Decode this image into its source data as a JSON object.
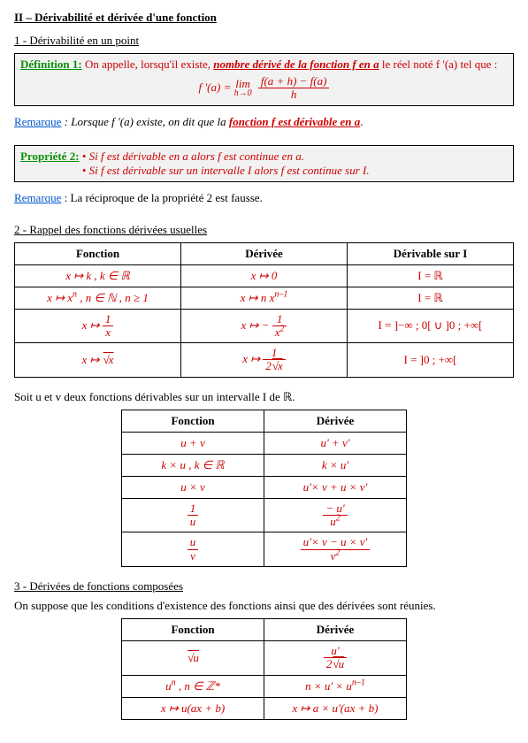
{
  "title": "II – Dérivabilité et dérivée d'une fonction",
  "sec1": "1 - Dérivabilité en un point",
  "def1": {
    "label": "Définition 1:",
    "text_before": " On appelle, lorsqu'il existe, ",
    "term": "nombre dérivé de la fonction  f  en  a",
    "text_after": "  le réel noté  f '(a)  tel que :",
    "formula_left": "f '(a) = ",
    "lim_top": "lim",
    "lim_bot": "h→0",
    "num": "f(a + h) − f(a)",
    "den": "h"
  },
  "rem1": {
    "label": "Remarque",
    "before": " : Lorsque  f '(a)  existe, on dit que la ",
    "bold": "fonction  f  est dérivable en  a",
    "after": "."
  },
  "prop2": {
    "label": "Propriété 2:",
    "line1": " •  Si  f  est dérivable en  a  alors  f  est continue en  a.",
    "line2": " •  Si  f  est dérivable sur un intervalle  I  alors  f  est continue sur I."
  },
  "rem2": {
    "label": "Remarque",
    "text": " : La réciproque de la propriété 2 est fausse."
  },
  "sec2": "2 - Rappel des fonctions dérivées usuelles",
  "t1": {
    "h1": "Fonction",
    "h2": "Dérivée",
    "h3": "Dérivable sur  I",
    "r1c1": "x ↦ k ,  k ∈ ℝ",
    "r1c2": "x ↦ 0",
    "r1c3": "I = ℝ",
    "r2c1_a": "x ↦ x",
    "r2c1_exp": "n",
    "r2c1_b": " ,  n ∈ ℕ ,  n ≥ 1",
    "r2c2_a": "x ↦ n x",
    "r2c2_exp": "n–1",
    "r2c3": "I = ℝ",
    "r3c1_pre": "x ↦ ",
    "r3c1_num": "1",
    "r3c1_den": "x",
    "r3c2_pre": "x ↦ − ",
    "r3c2_num": "1",
    "r3c2_den": "x",
    "r3c2_exp": "2",
    "r3c3": "I = ]−∞ ; 0[ ∪ ]0 ; +∞[",
    "r4c1_pre": "x ↦ ",
    "r4c1_sq": "x",
    "r4c2_pre": "x ↦ ",
    "r4c2_num": "1",
    "r4c2_den_a": "2",
    "r4c2_den_sq": "x",
    "r4c3": "I = ]0 ; +∞["
  },
  "t2intro": "Soit  u  et  v  deux fonctions dérivables sur un intervalle  I  de  ℝ.",
  "t2": {
    "h1": "Fonction",
    "h2": "Dérivée",
    "r1c1": "u + v",
    "r1c2": "u' + v'",
    "r2c1": "k × u ,  k ∈ ℝ",
    "r2c2": "k × u'",
    "r3c1": "u × v",
    "r3c2": "u'× v + u × v'",
    "r4c1_num": "1",
    "r4c1_den": "u",
    "r4c2_num": "− u'",
    "r4c2_den": "u",
    "r4c2_exp": "2",
    "r5c1_num": "u",
    "r5c1_den": "v",
    "r5c2_num": "u'× v − u × v'",
    "r5c2_den": "v",
    "r5c2_exp": "2"
  },
  "sec3": "3 - Dérivées de fonctions composées",
  "sec3text": "On suppose que les conditions d'existence des fonctions ainsi que des dérivées sont réunies.",
  "t3": {
    "h1": "Fonction",
    "h2": "Dérivée",
    "r1c1_sq": "u",
    "r1c2_num": "u'",
    "r1c2_den_a": "2",
    "r1c2_den_sq": "u",
    "r2c1_a": "u",
    "r2c1_exp": "n",
    "r2c1_b": " ,  n ∈ ℤ*",
    "r2c2_a": "n × u' × u",
    "r2c2_exp": "n–1",
    "r3c1": "x ↦ u(ax + b)",
    "r3c2": "x ↦ a × u'(ax + b)"
  }
}
